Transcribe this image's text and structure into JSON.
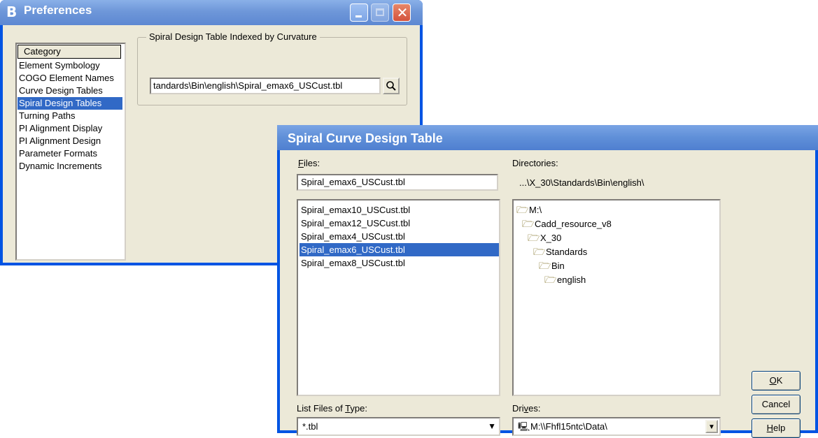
{
  "preferences": {
    "title": "Preferences",
    "app_icon": "B",
    "close_glyph": "✕",
    "category_header": "Category",
    "categories": [
      "Element Symbology",
      "COGO Element Names",
      "Curve Design Tables",
      "Spiral Design Tables",
      "Turning Paths",
      "PI Alignment Display",
      "PI Alignment Design",
      "Parameter Formats",
      "Dynamic Increments"
    ],
    "selected_category": "Spiral Design Tables",
    "group_label": "Spiral Design Table Indexed by Curvature",
    "path_value": "tandards\\Bin\\english\\Spiral_emax6_USCust.tbl",
    "browse_icon": "search-icon"
  },
  "dialog": {
    "title": "Spiral Curve Design Table",
    "files_label_prefix": "",
    "files_label_underline": "F",
    "files_label_suffix": "iles:",
    "file_name_value": "Spiral_emax6_USCust.tbl",
    "files": [
      "Spiral_emax10_USCust.tbl",
      "Spiral_emax12_USCust.tbl",
      "Spiral_emax4_USCust.tbl",
      "Spiral_emax6_USCust.tbl",
      "Spiral_emax8_USCust.tbl"
    ],
    "selected_file": "Spiral_emax6_USCust.tbl",
    "directories_label": "Directories:",
    "current_dir": "...\\X_30\\Standards\\Bin\\english\\",
    "dirs": [
      "M:\\",
      "Cadd_resource_v8",
      "X_30",
      "Standards",
      "Bin",
      "english"
    ],
    "type_label_prefix": "List Files of ",
    "type_label_underline": "T",
    "type_label_suffix": "ype:",
    "type_value": "*.tbl",
    "drives_label_prefix": "Dri",
    "drives_label_underline": "v",
    "drives_label_suffix": "es:",
    "drive_value": "M:\\\\Fhfl15ntc\\Data\\",
    "ok_underline": "O",
    "ok_rest": "K",
    "cancel_label": "Cancel",
    "help_underline": "H",
    "help_rest": "elp",
    "drop_glyph": "▼",
    "folder_glyph": "🗁",
    "drive_glyph": "🖳"
  }
}
